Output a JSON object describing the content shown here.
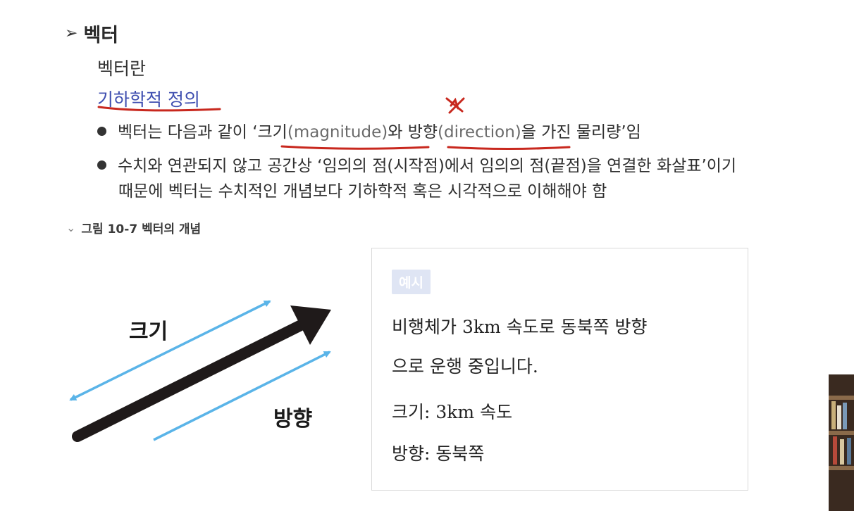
{
  "heading": {
    "arrow": "➢",
    "title": "벡터"
  },
  "subtitle": "벡터란",
  "definition_heading": "기하학적 정의",
  "bullets": {
    "b1_pre": "벡터는 다음과 같이 ‘크기",
    "b1_en1": "(magnitude)",
    "b1_mid": "와 방향",
    "b1_en2": "(direction)",
    "b1_post": "을 가진 물리량’임",
    "b2_line1": "수치와 연관되지 않고 공간상 ‘임의의 점(시작점)에서 임의의 점(끝점)을 연결한 화살표’이기",
    "b2_line2": "때문에 벡터는 수치적인 개념보다 기하학적 혹은 시각적으로 이해해야 함"
  },
  "figure_caption": {
    "chevron": "⌄",
    "text": "그림 10-7 벡터의 개념"
  },
  "diagram": {
    "label_size": "크기",
    "label_direction": "방향",
    "arrow_color": "#5ab4e8",
    "main_arrow_color": "#1f1a1a"
  },
  "example": {
    "badge": "예시",
    "line1": "비행체가 3km 속도로 동북쪽 방향",
    "line2": "으로 운행 중입니다.",
    "line3": "크기: 3km 속도",
    "line4": "방향: 동북쪽"
  },
  "colors": {
    "definition": "#3f4fb0",
    "annotation": "#c8281e",
    "badge_bg": "#dfe5f4"
  }
}
